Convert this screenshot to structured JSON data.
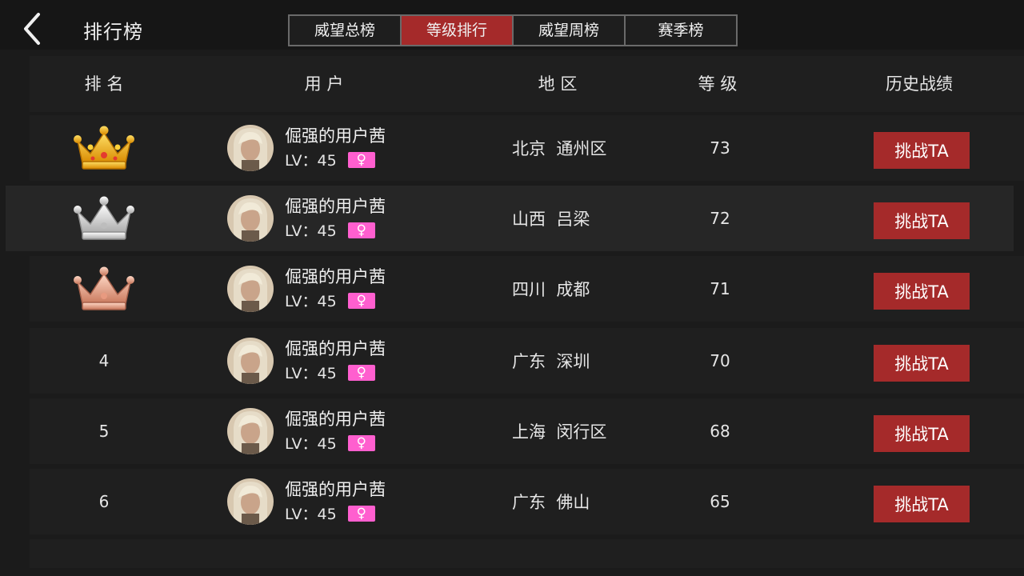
{
  "header": {
    "title": "排行榜",
    "tabs": [
      {
        "label": "威望总榜",
        "active": false
      },
      {
        "label": "等级排行",
        "active": true
      },
      {
        "label": "威望周榜",
        "active": false
      },
      {
        "label": "赛季榜",
        "active": false
      }
    ]
  },
  "table": {
    "columns": {
      "rank": "排 名",
      "user": "用 户",
      "region": "地 区",
      "level": "等 级",
      "history": "历史战绩"
    },
    "rows": [
      {
        "rank": "1",
        "rank_icon": "gold-crown-icon",
        "name": "倔强的用户茜",
        "lv": "LV：45",
        "gender": "♀",
        "region": "北京  通州区",
        "level": "73",
        "action": "挑战TA"
      },
      {
        "rank": "2",
        "rank_icon": "silver-crown-icon",
        "name": "倔强的用户茜",
        "lv": "LV：45",
        "gender": "♀",
        "region": "山西  吕梁",
        "level": "72",
        "action": "挑战TA"
      },
      {
        "rank": "3",
        "rank_icon": "bronze-crown-icon",
        "name": "倔强的用户茜",
        "lv": "LV：45",
        "gender": "♀",
        "region": "四川  成都",
        "level": "71",
        "action": "挑战TA"
      },
      {
        "rank": "4",
        "name": "倔强的用户茜",
        "lv": "LV：45",
        "gender": "♀",
        "region": "广东  深圳",
        "level": "70",
        "action": "挑战TA"
      },
      {
        "rank": "5",
        "name": "倔强的用户茜",
        "lv": "LV：45",
        "gender": "♀",
        "region": "上海  闵行区",
        "level": "68",
        "action": "挑战TA"
      },
      {
        "rank": "6",
        "name": "倔强的用户茜",
        "lv": "LV：45",
        "gender": "♀",
        "region": "广东  佛山",
        "level": "65",
        "action": "挑战TA"
      }
    ]
  },
  "colors": {
    "accent": "#a52a2a",
    "gender_badge": "#ff5fcf",
    "gold": "#f2b320",
    "silver": "#cfcfcf",
    "bronze": "#e9a58c"
  }
}
